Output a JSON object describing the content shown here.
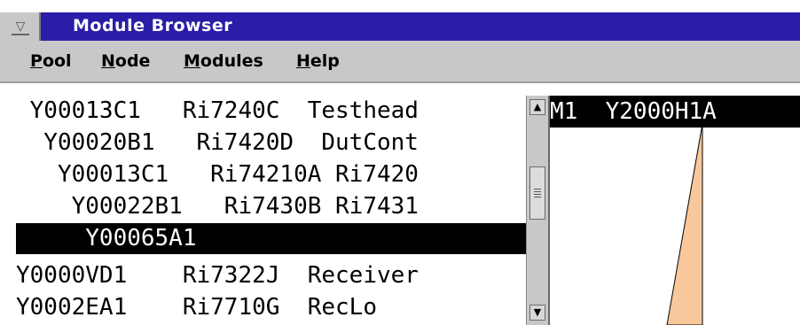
{
  "window": {
    "title": "Module Browser",
    "system_menu_icon": "window-menu-icon"
  },
  "menubar": {
    "items": [
      {
        "accel": "P",
        "rest": "ool"
      },
      {
        "accel": "N",
        "rest": "ode"
      },
      {
        "accel": "M",
        "rest": "odules"
      },
      {
        "accel": "H",
        "rest": "elp"
      }
    ]
  },
  "module_list": {
    "rows": [
      {
        "text": " Y00013C1   Ri7240C  Testhead",
        "selected": false
      },
      {
        "text": "  Y00020B1   Ri7420D  DutCont",
        "selected": false
      },
      {
        "text": "   Y00013C1   Ri74210A Ri7420",
        "selected": false
      },
      {
        "text": "    Y00022B1   Ri7430B Ri7431",
        "selected": false
      },
      {
        "text": "     Y00065A1",
        "selected": true
      },
      {
        "text": "Y0000VD1    Ri7322J  Receiver",
        "selected": false
      },
      {
        "text": "Y0002EA1    Ri7710G  RecLo",
        "selected": false
      }
    ],
    "scrollbar": {
      "up_icon": "scroll-up-arrow-icon",
      "down_icon": "scroll-down-arrow-icon"
    }
  },
  "detail_panel": {
    "header": "M1  Y2000H1A",
    "wedge_color": "#f8c89c"
  }
}
